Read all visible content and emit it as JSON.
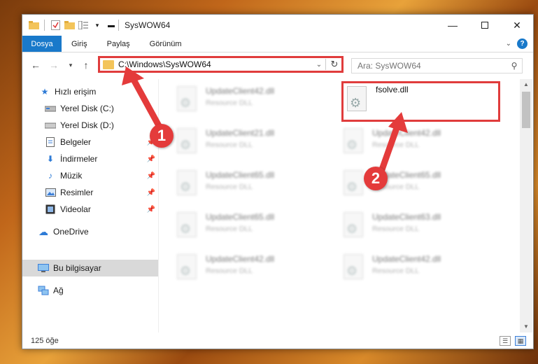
{
  "window": {
    "title": "SysWOW64"
  },
  "ribbon": {
    "tabs": [
      "Dosya",
      "Giriş",
      "Paylaş",
      "Görünüm"
    ],
    "help_label": "?"
  },
  "address": {
    "path": "C:\\Windows\\SysWOW64"
  },
  "search": {
    "placeholder": "Ara: SysWOW64"
  },
  "sidebar": {
    "items": [
      {
        "label": "Hızlı erişim",
        "icon": "star-icon"
      },
      {
        "label": "Yerel Disk (C:)",
        "icon": "drive-icon"
      },
      {
        "label": "Yerel Disk (D:)",
        "icon": "drive-icon"
      },
      {
        "label": "Belgeler",
        "icon": "document-icon"
      },
      {
        "label": "İndirmeler",
        "icon": "download-icon"
      },
      {
        "label": "Müzik",
        "icon": "music-icon"
      },
      {
        "label": "Resimler",
        "icon": "picture-icon"
      },
      {
        "label": "Videolar",
        "icon": "video-icon"
      },
      {
        "label": "OneDrive",
        "icon": "cloud-icon"
      },
      {
        "label": "Bu bilgisayar",
        "icon": "computer-icon"
      },
      {
        "label": "Ağ",
        "icon": "network-icon"
      }
    ]
  },
  "files": [
    {
      "name": "UpdateClient42.dll",
      "type": "Resource DLL"
    },
    {
      "name": "fsolve.dll",
      "type": ""
    },
    {
      "name": "UpdateClient21.dll",
      "type": "Resource DLL"
    },
    {
      "name": "UpdateClient42.dll",
      "type": "Resource DLL"
    },
    {
      "name": "UpdateClient65.dll",
      "type": "Resource DLL"
    },
    {
      "name": "UpdateClient65.dll",
      "type": "Resource DLL"
    },
    {
      "name": "UpdateClient65.dll",
      "type": "Resource DLL"
    },
    {
      "name": "UpdateClient63.dll",
      "type": "Resource DLL"
    },
    {
      "name": "UpdateClient42.dll",
      "type": "Resource DLL"
    },
    {
      "name": "UpdateClient42.dll",
      "type": "Resource DLL"
    }
  ],
  "status": {
    "count": "125 öğe"
  },
  "annotations": {
    "step1": "1",
    "step2": "2"
  },
  "colors": {
    "accent": "#1979ca",
    "highlight": "#e03c3c"
  }
}
